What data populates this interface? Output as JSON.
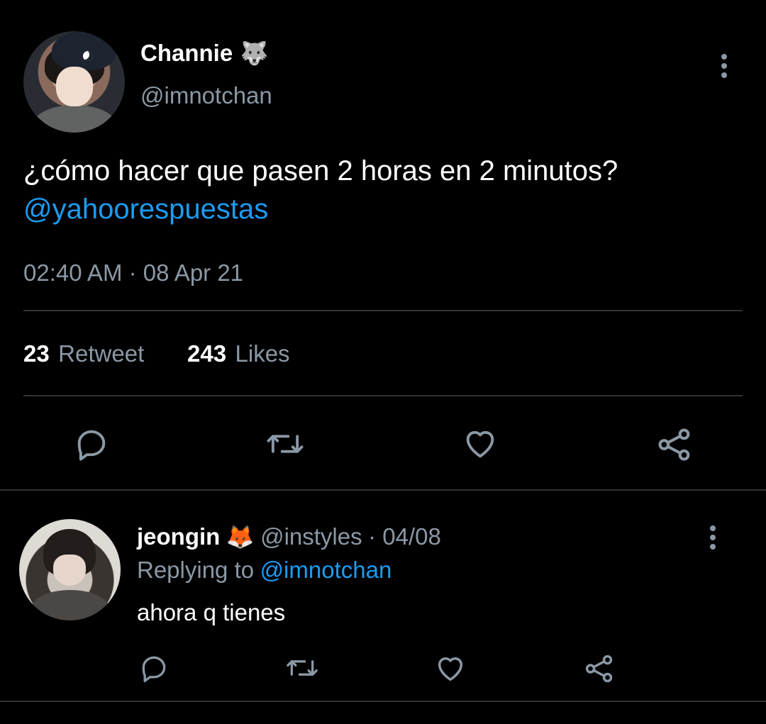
{
  "main_tweet": {
    "author_name": "Channie",
    "author_emoji": "🐺",
    "author_handle": "@imnotchan",
    "text_lead": "¿cómo hacer que pasen 2 horas en 2 minutos?",
    "text_mention": "@yahoorespuestas",
    "timestamp": "02:40 AM · 08 Apr 21",
    "retweet_count": "23",
    "retweet_label": "Retweet",
    "likes_count": "243",
    "likes_label": "Likes"
  },
  "actions": {
    "reply_icon": "speech-bubble-icon",
    "retweet_icon": "retweet-arrows-icon",
    "like_icon": "heart-icon",
    "share_icon": "share-nodes-icon"
  },
  "reply": {
    "author_name": "jeongin",
    "author_emoji": "🦊",
    "author_handle": "@instyles",
    "date": "· 04/08",
    "replying_label": "Replying to",
    "replying_handle": "@imnotchan",
    "text": "ahora q tienes"
  },
  "colors": {
    "background": "#000000",
    "text_primary": "#ffffff",
    "text_secondary": "#8b98a5",
    "accent": "#1d9bf0",
    "divider": "#2f3336"
  }
}
